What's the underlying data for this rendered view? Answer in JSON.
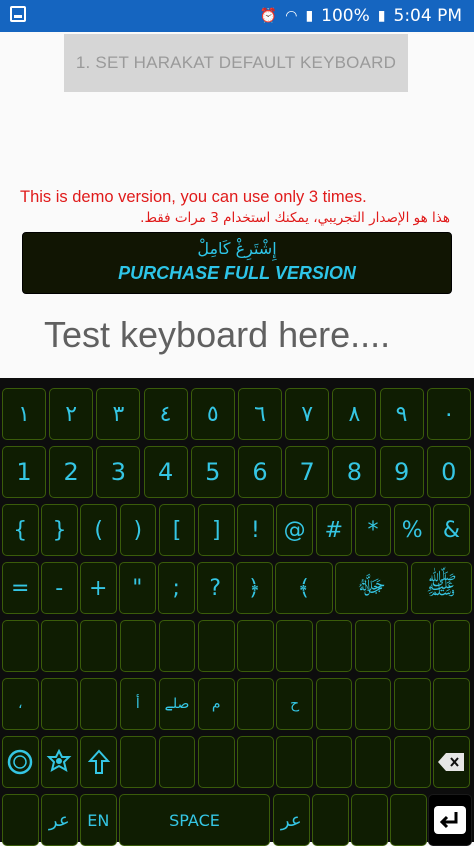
{
  "status_bar": {
    "battery_text": "100%",
    "time": "5:04 PM"
  },
  "app": {
    "set_keyboard_button": "1. SET HARAKAT DEFAULT KEYBOARD",
    "demo_notice_en": "This is demo version, you can use only 3 times.",
    "demo_notice_ar": "هذا هو الإصدار التجريبي، يمكنك استخدام 3 مرات فقط.",
    "purchase_ar": "إِشْتَرِغْ كَامِلْ",
    "purchase_en": "PURCHASE FULL VERSION",
    "test_placeholder": "Test keyboard here...."
  },
  "keyboard": {
    "colors": {
      "text": "#35c6e4",
      "key_bg": "#0f1d02",
      "key_border": "#3a5c0a"
    },
    "row1": [
      "١",
      "٢",
      "٣",
      "٤",
      "٥",
      "٦",
      "٧",
      "٨",
      "٩",
      "٠"
    ],
    "row2": [
      "1",
      "2",
      "3",
      "4",
      "5",
      "6",
      "7",
      "8",
      "9",
      "0"
    ],
    "row3": [
      "{",
      "}",
      "(",
      ")",
      "[",
      "]",
      "!",
      "@",
      "#",
      "*",
      "%",
      "&"
    ],
    "row4": [
      "=",
      "-",
      "+",
      "\"",
      ";",
      "?",
      "﴿",
      "﴾",
      "ﷻ",
      "ﷺ"
    ],
    "row5": [
      "",
      "",
      "",
      "",
      "",
      "",
      "",
      "",
      "",
      "",
      "",
      ""
    ],
    "row6": [
      "،",
      "",
      "",
      "أ",
      "صلے",
      "م",
      "",
      "ح",
      "",
      "",
      "",
      ""
    ],
    "row7": [
      "",
      "",
      "",
      "",
      "",
      "",
      "",
      "",
      "",
      "",
      "",
      ""
    ],
    "row8": {
      "arabic_left": "عر",
      "en": "EN",
      "space": "SPACE",
      "arabic_right": "عر"
    },
    "icons": [
      "ring-icon",
      "octagon-star-icon",
      "arrow-up-icon",
      "backspace-icon",
      "enter-icon"
    ]
  }
}
